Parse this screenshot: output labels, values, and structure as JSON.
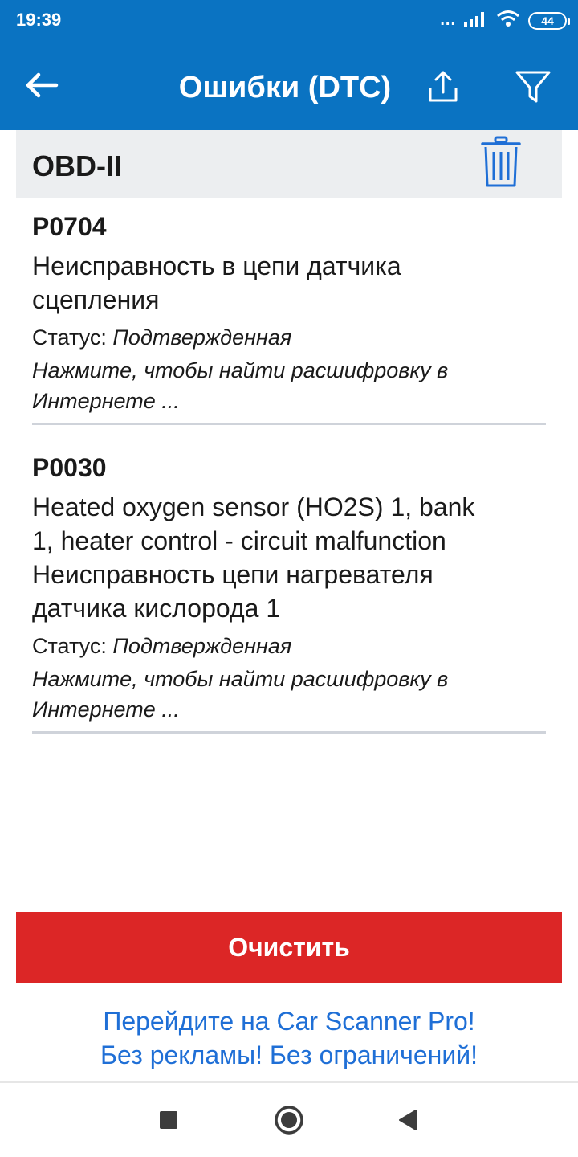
{
  "status_bar": {
    "time": "19:39",
    "dots": "...",
    "battery": "44"
  },
  "app_bar": {
    "title": "Ошибки (DTC)"
  },
  "section": {
    "title": "OBD-II"
  },
  "dtcs": [
    {
      "code": "P0704",
      "description": "Неисправность в цепи датчика\nсцепления",
      "status_label": "Статус: ",
      "status_value": "Подтвержденная",
      "link": "Нажмите, чтобы найти расшифровку в\nИнтернете ..."
    },
    {
      "code": "P0030",
      "description": "Heated oxygen sensor (HO2S) 1, bank\n1, heater control - circuit malfunction\nНеисправность цепи нагревателя\nдатчика кислорода 1",
      "status_label": "Статус: ",
      "status_value": "Подтвержденная",
      "link": "Нажмите, чтобы найти расшифровку в\nИнтернете ..."
    }
  ],
  "clear_button": {
    "label": "Очистить"
  },
  "promo": {
    "line1": "Перейдите на Car Scanner Pro!",
    "line2": "Без рекламы! Без ограничений!"
  },
  "icons": {
    "back": "arrow-left-icon",
    "share": "share-icon",
    "filter": "filter-icon",
    "trash": "trash-icon",
    "nav_recents": "square-icon",
    "nav_home": "circle-icon",
    "nav_back": "triangle-back-icon"
  },
  "colors": {
    "primary": "#0a73c2",
    "danger": "#dc2626",
    "link": "#1f6fd6",
    "section_bg": "#eceef0"
  }
}
